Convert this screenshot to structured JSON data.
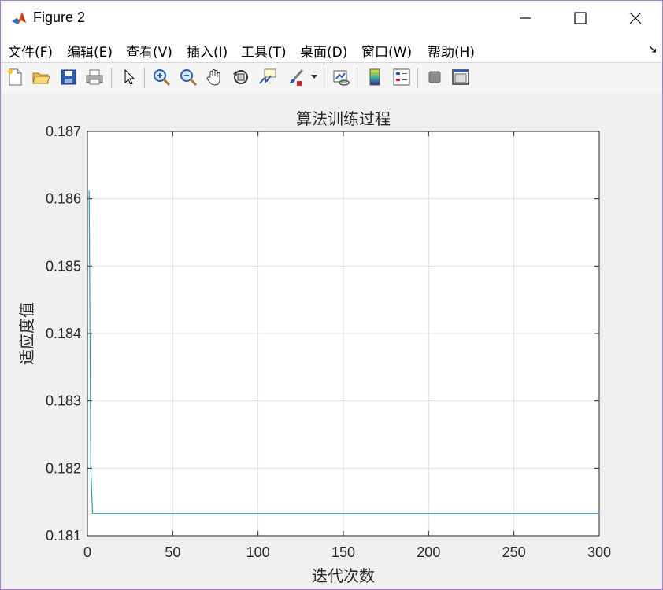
{
  "window": {
    "title": "Figure 2",
    "accent_border": "#a678d8"
  },
  "menu": {
    "items": [
      "文件(F)",
      "编辑(E)",
      "查看(V)",
      "插入(I)",
      "工具(T)",
      "桌面(D)",
      "窗口(W)",
      "帮助(H)"
    ]
  },
  "toolbar": {
    "icons": [
      "new-figure-icon",
      "open-file-icon",
      "save-icon",
      "print-icon",
      "pointer-icon",
      "zoom-in-icon",
      "zoom-out-icon",
      "pan-hand-icon",
      "rotate-3d-icon",
      "data-cursor-icon",
      "brush-icon",
      "link-plot-icon",
      "colorbar-icon",
      "legend-icon",
      "hide-plot-tools-icon",
      "show-plot-tools-icon"
    ]
  },
  "chart_data": {
    "type": "line",
    "title": "算法训练过程",
    "xlabel": "迭代次数",
    "ylabel": "适应度值",
    "xlim": [
      0,
      300
    ],
    "ylim": [
      0.181,
      0.187
    ],
    "xticks": [
      0,
      50,
      100,
      150,
      200,
      250,
      300
    ],
    "yticks": [
      0.181,
      0.182,
      0.183,
      0.184,
      0.185,
      0.186,
      0.187
    ],
    "grid": true,
    "series": [
      {
        "color": "#2e9bb5",
        "x": [
          1,
          2,
          3,
          300
        ],
        "y": [
          0.18612,
          0.182,
          0.18133,
          0.18133
        ]
      }
    ]
  }
}
